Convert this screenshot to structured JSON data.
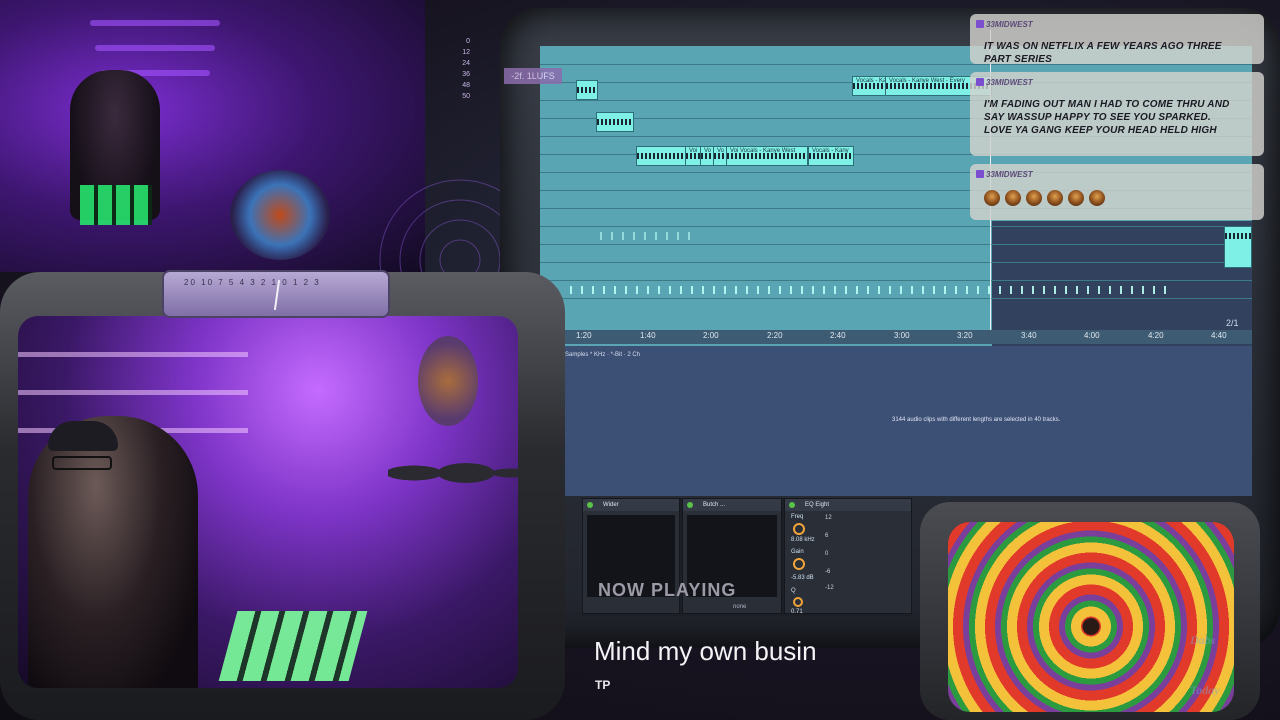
{
  "chat": [
    {
      "user": "33MIDWEST",
      "message": "IT WAS ON NETFLIX A FEW YEARS AGO THREE PART SERIES"
    },
    {
      "user": "33MIDWEST",
      "message": "I'M FADING OUT MAN I HAD TO COME THRU AND SAY WASSUP HAPPY TO SEE YOU SPARKED. LOVE YA GANG KEEP YOUR HEAD HELD HIGH"
    },
    {
      "user": "33MIDWEST",
      "emote_count": 6,
      "emote_icon": "face-emote-icon"
    }
  ],
  "daw": {
    "lufs_badge": "-2f. 1LUFS",
    "meter_scale": [
      "0",
      "12",
      "24",
      "36",
      "48",
      "50"
    ],
    "clip_labels": [
      "Vocals - Ka",
      "Vocals - Kanye West - Every",
      "Voi",
      "Vo",
      "Vo",
      "Voi Vocals - Kanye West",
      "Vocals - Kany"
    ],
    "ruler_labels": [
      "1:20",
      "1:40",
      "2:00",
      "2:20",
      "2:40",
      "3:00",
      "3:20",
      "3:40",
      "4:00",
      "4:20",
      "4:40"
    ],
    "page_counter": "2/1",
    "detail_info": "Samples  * KHz · *-Bit · 2 Ch",
    "selection_message": "3144 audio clips with different lengths are selected in 40 tracks.",
    "devices": [
      {
        "name": "Wider",
        "footer": ""
      },
      {
        "name": "Butch ...",
        "footer": "none"
      },
      {
        "name": "EQ Eight",
        "freq_label": "Freq",
        "freq_value": "8.08 kHz",
        "gain_label": "Gain",
        "gain_value": "-5.83 dB",
        "q_label": "Q",
        "q_value": "0.71",
        "scale": [
          "12",
          "6",
          "0",
          "-6",
          "-12"
        ]
      }
    ]
  },
  "vu_meter": {
    "scale": "20 10 7 5 4 3 2 1 0 1 2 3"
  },
  "now_playing": {
    "label": "NOW PLAYING",
    "title": "Mind my own busin",
    "artist": "TP"
  },
  "watermark": {
    "line1": "Dabs",
    "line2": "Today"
  },
  "colors": {
    "daw_arrangement": "#5aa5b3",
    "clip": "#7ef0e6",
    "detail_panel": "#3c4f74",
    "chat_bubble": "#d2d2cd",
    "accent_purple": "#7b4fd0",
    "device_active": "#59c34a"
  }
}
